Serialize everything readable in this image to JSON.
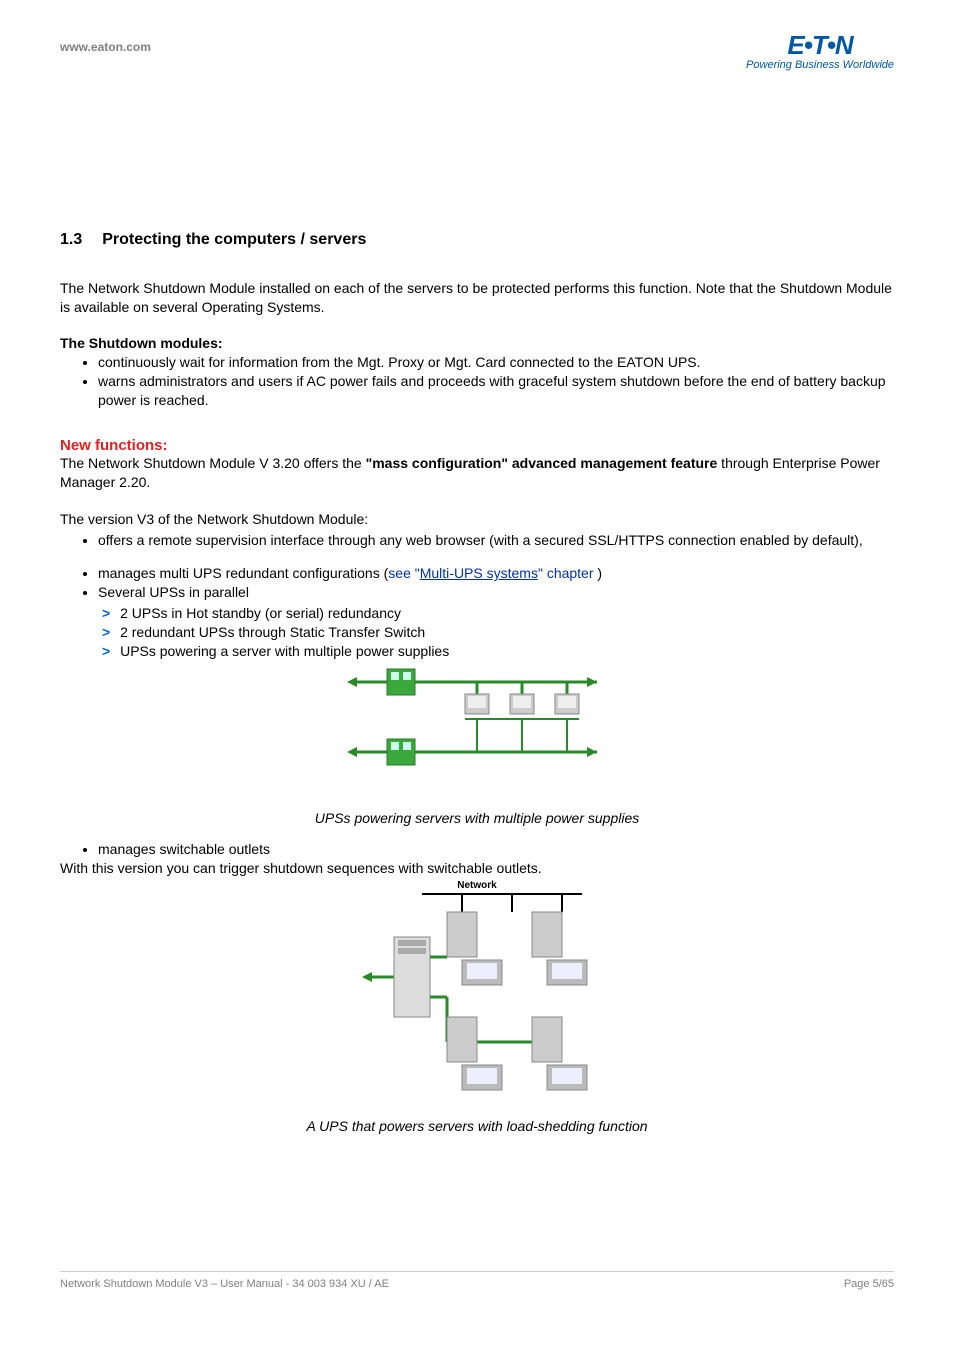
{
  "header": {
    "url": "www.eaton.com",
    "logo_main": "E•T•N",
    "logo_tagline": "Powering Business Worldwide"
  },
  "section": {
    "number": "1.3",
    "title": "Protecting the computers / servers"
  },
  "intro_para": "The Network Shutdown Module installed on each of the servers to be protected performs this function. Note that the Shutdown Module is available on several Operating Systems.",
  "shutdown_heading": "The Shutdown modules:",
  "shutdown_bullets": [
    "continuously wait for information from the Mgt. Proxy or Mgt. Card connected to the EATON UPS.",
    "warns administrators and users if AC power fails and proceeds with graceful system shutdown before the end of battery backup power is reached."
  ],
  "new_functions_heading": "New functions:",
  "new_functions_para_pre": "The Network Shutdown Module V 3.20 offers the ",
  "new_functions_para_bold": "\"mass configuration\" advanced management feature",
  "new_functions_para_post": " through Enterprise Power Manager 2.20.",
  "v3_intro": "The version V3 of the Network Shutdown Module:",
  "v3_bullet1": "offers a remote supervision interface through any web browser (with a secured SSL/HTTPS connection enabled by default),",
  "v3_bullet2_pre": "manages multi UPS redundant configurations (",
  "v3_bullet2_link_pre": "see \"",
  "v3_bullet2_link_text": "Multi-UPS systems",
  "v3_bullet2_link_post": "\" chapter ",
  "v3_bullet2_post": ")",
  "v3_bullet3": "Several UPSs in parallel",
  "chevrons": [
    "2 UPSs in Hot standby (or serial) redundancy",
    "2 redundant UPSs through Static Transfer Switch",
    "UPSs powering a server with multiple power supplies"
  ],
  "caption1": "UPSs powering servers with multiple power supplies",
  "v3_bullet4": " manages switchable outlets",
  "switchable_para": "With this version you can trigger shutdown sequences with switchable outlets.",
  "network_label": "Network",
  "caption2": "A UPS that powers servers with load-shedding function",
  "footer": {
    "left": "Network Shutdown Module V3 – User Manual - 34 003 934 XU / AE",
    "right": "Page 5/65"
  }
}
